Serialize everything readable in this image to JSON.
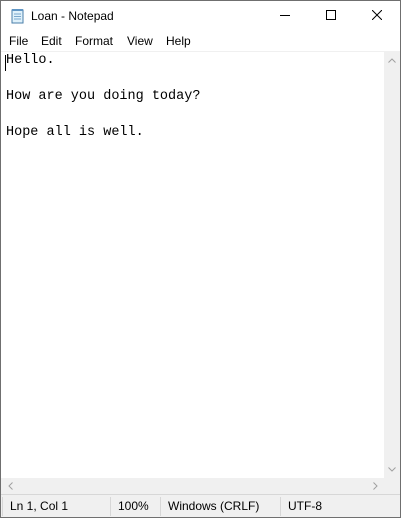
{
  "window": {
    "title": "Loan - Notepad",
    "app_icon": "notepad-icon",
    "controls": {
      "minimize_icon": "minimize-icon",
      "maximize_icon": "maximize-icon",
      "close_icon": "close-icon"
    }
  },
  "menubar": {
    "items": [
      {
        "label": "File"
      },
      {
        "label": "Edit"
      },
      {
        "label": "Format"
      },
      {
        "label": "View"
      },
      {
        "label": "Help"
      }
    ]
  },
  "editor": {
    "content": "Hello.\n\nHow are you doing today?\n\nHope all is well."
  },
  "statusbar": {
    "position": "Ln 1, Col 1",
    "zoom": "100%",
    "line_ending": "Windows (CRLF)",
    "encoding": "UTF-8"
  },
  "colors": {
    "window_bg": "#ffffff",
    "chrome_bg": "#f0f0f0",
    "border": "#6f6f6f",
    "text": "#000000"
  }
}
